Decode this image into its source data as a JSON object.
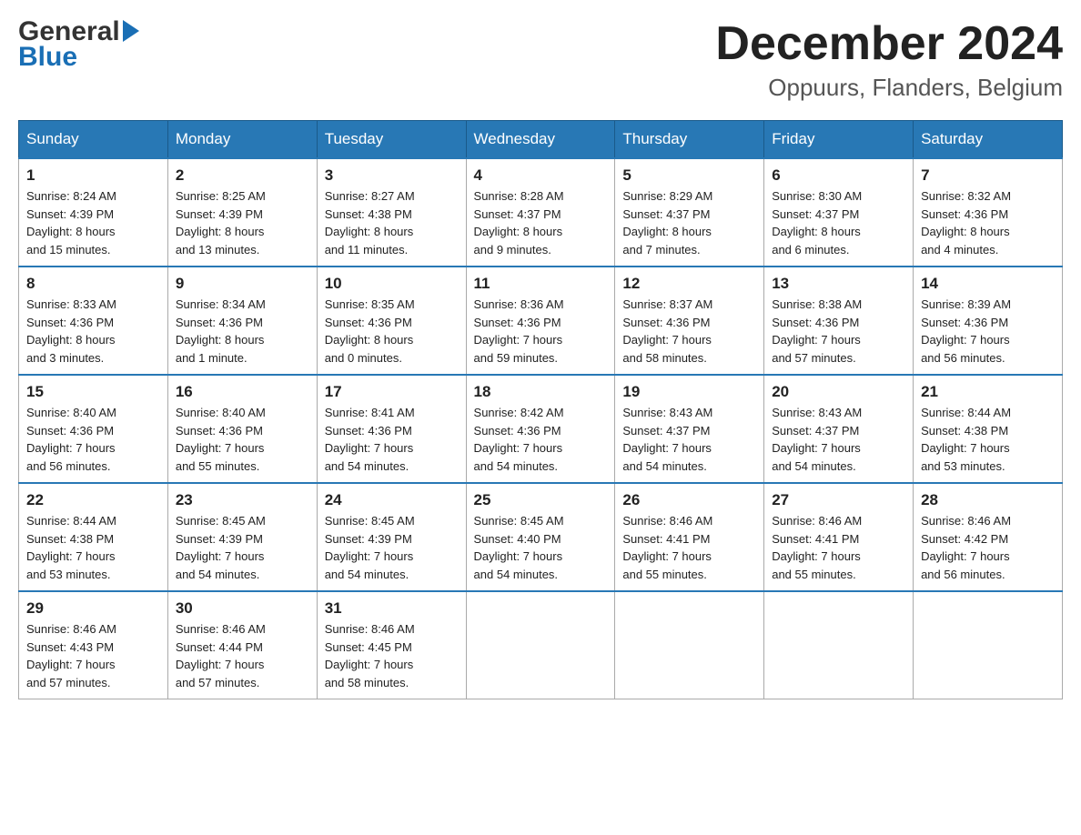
{
  "header": {
    "month_title": "December 2024",
    "location": "Oppuurs, Flanders, Belgium",
    "logo_general": "General",
    "logo_blue": "Blue"
  },
  "weekdays": [
    "Sunday",
    "Monday",
    "Tuesday",
    "Wednesday",
    "Thursday",
    "Friday",
    "Saturday"
  ],
  "weeks": [
    [
      {
        "day": "1",
        "sunrise": "8:24 AM",
        "sunset": "4:39 PM",
        "daylight": "8 hours and 15 minutes."
      },
      {
        "day": "2",
        "sunrise": "8:25 AM",
        "sunset": "4:39 PM",
        "daylight": "8 hours and 13 minutes."
      },
      {
        "day": "3",
        "sunrise": "8:27 AM",
        "sunset": "4:38 PM",
        "daylight": "8 hours and 11 minutes."
      },
      {
        "day": "4",
        "sunrise": "8:28 AM",
        "sunset": "4:37 PM",
        "daylight": "8 hours and 9 minutes."
      },
      {
        "day": "5",
        "sunrise": "8:29 AM",
        "sunset": "4:37 PM",
        "daylight": "8 hours and 7 minutes."
      },
      {
        "day": "6",
        "sunrise": "8:30 AM",
        "sunset": "4:37 PM",
        "daylight": "8 hours and 6 minutes."
      },
      {
        "day": "7",
        "sunrise": "8:32 AM",
        "sunset": "4:36 PM",
        "daylight": "8 hours and 4 minutes."
      }
    ],
    [
      {
        "day": "8",
        "sunrise": "8:33 AM",
        "sunset": "4:36 PM",
        "daylight": "8 hours and 3 minutes."
      },
      {
        "day": "9",
        "sunrise": "8:34 AM",
        "sunset": "4:36 PM",
        "daylight": "8 hours and 1 minute."
      },
      {
        "day": "10",
        "sunrise": "8:35 AM",
        "sunset": "4:36 PM",
        "daylight": "8 hours and 0 minutes."
      },
      {
        "day": "11",
        "sunrise": "8:36 AM",
        "sunset": "4:36 PM",
        "daylight": "7 hours and 59 minutes."
      },
      {
        "day": "12",
        "sunrise": "8:37 AM",
        "sunset": "4:36 PM",
        "daylight": "7 hours and 58 minutes."
      },
      {
        "day": "13",
        "sunrise": "8:38 AM",
        "sunset": "4:36 PM",
        "daylight": "7 hours and 57 minutes."
      },
      {
        "day": "14",
        "sunrise": "8:39 AM",
        "sunset": "4:36 PM",
        "daylight": "7 hours and 56 minutes."
      }
    ],
    [
      {
        "day": "15",
        "sunrise": "8:40 AM",
        "sunset": "4:36 PM",
        "daylight": "7 hours and 56 minutes."
      },
      {
        "day": "16",
        "sunrise": "8:40 AM",
        "sunset": "4:36 PM",
        "daylight": "7 hours and 55 minutes."
      },
      {
        "day": "17",
        "sunrise": "8:41 AM",
        "sunset": "4:36 PM",
        "daylight": "7 hours and 54 minutes."
      },
      {
        "day": "18",
        "sunrise": "8:42 AM",
        "sunset": "4:36 PM",
        "daylight": "7 hours and 54 minutes."
      },
      {
        "day": "19",
        "sunrise": "8:43 AM",
        "sunset": "4:37 PM",
        "daylight": "7 hours and 54 minutes."
      },
      {
        "day": "20",
        "sunrise": "8:43 AM",
        "sunset": "4:37 PM",
        "daylight": "7 hours and 54 minutes."
      },
      {
        "day": "21",
        "sunrise": "8:44 AM",
        "sunset": "4:38 PM",
        "daylight": "7 hours and 53 minutes."
      }
    ],
    [
      {
        "day": "22",
        "sunrise": "8:44 AM",
        "sunset": "4:38 PM",
        "daylight": "7 hours and 53 minutes."
      },
      {
        "day": "23",
        "sunrise": "8:45 AM",
        "sunset": "4:39 PM",
        "daylight": "7 hours and 54 minutes."
      },
      {
        "day": "24",
        "sunrise": "8:45 AM",
        "sunset": "4:39 PM",
        "daylight": "7 hours and 54 minutes."
      },
      {
        "day": "25",
        "sunrise": "8:45 AM",
        "sunset": "4:40 PM",
        "daylight": "7 hours and 54 minutes."
      },
      {
        "day": "26",
        "sunrise": "8:46 AM",
        "sunset": "4:41 PM",
        "daylight": "7 hours and 55 minutes."
      },
      {
        "day": "27",
        "sunrise": "8:46 AM",
        "sunset": "4:41 PM",
        "daylight": "7 hours and 55 minutes."
      },
      {
        "day": "28",
        "sunrise": "8:46 AM",
        "sunset": "4:42 PM",
        "daylight": "7 hours and 56 minutes."
      }
    ],
    [
      {
        "day": "29",
        "sunrise": "8:46 AM",
        "sunset": "4:43 PM",
        "daylight": "7 hours and 57 minutes."
      },
      {
        "day": "30",
        "sunrise": "8:46 AM",
        "sunset": "4:44 PM",
        "daylight": "7 hours and 57 minutes."
      },
      {
        "day": "31",
        "sunrise": "8:46 AM",
        "sunset": "4:45 PM",
        "daylight": "7 hours and 58 minutes."
      },
      null,
      null,
      null,
      null
    ]
  ],
  "labels": {
    "sunrise": "Sunrise:",
    "sunset": "Sunset:",
    "daylight": "Daylight:"
  }
}
